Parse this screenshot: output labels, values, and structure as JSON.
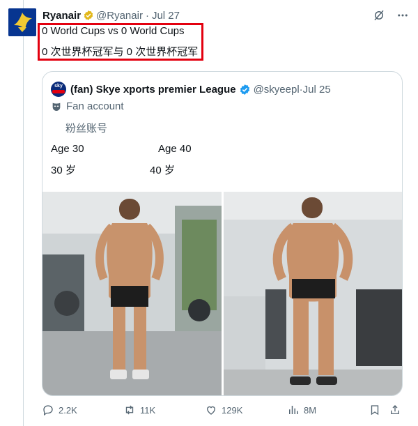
{
  "tweet": {
    "author_name": "Ryanair",
    "author_handle": "@Ryanair",
    "date": "Jul 27",
    "text_line1": "0 World Cups vs 0 World Cups",
    "text_line2": "0 次世界杯冠军与 0 次世界杯冠军"
  },
  "quoted": {
    "author_name": "(fan) Skye xports premier League",
    "author_handle": "@skyeepl",
    "date": "Jul 25",
    "fan_label": "Fan account",
    "fan_label_zh": "粉丝账号",
    "left_caption": "Age 30",
    "right_caption": "Age 40",
    "left_caption_zh": "30 岁",
    "right_caption_zh": "40 岁"
  },
  "actions": {
    "replies": "2.2K",
    "reposts": "11K",
    "likes": "129K",
    "views": "8M"
  },
  "colors": {
    "highlight_box": "#e3000f",
    "verified_gold": "#e2b719",
    "verified_blue": "#1d9bf0",
    "muted_text": "#536471",
    "ryanair_blue": "#073590"
  },
  "icons": [
    "grok-icon",
    "more-icon",
    "verified-gold-icon",
    "verified-blue-icon",
    "fan-mask-icon",
    "reply-icon",
    "repost-icon",
    "like-icon",
    "views-icon",
    "bookmark-icon",
    "share-icon"
  ]
}
